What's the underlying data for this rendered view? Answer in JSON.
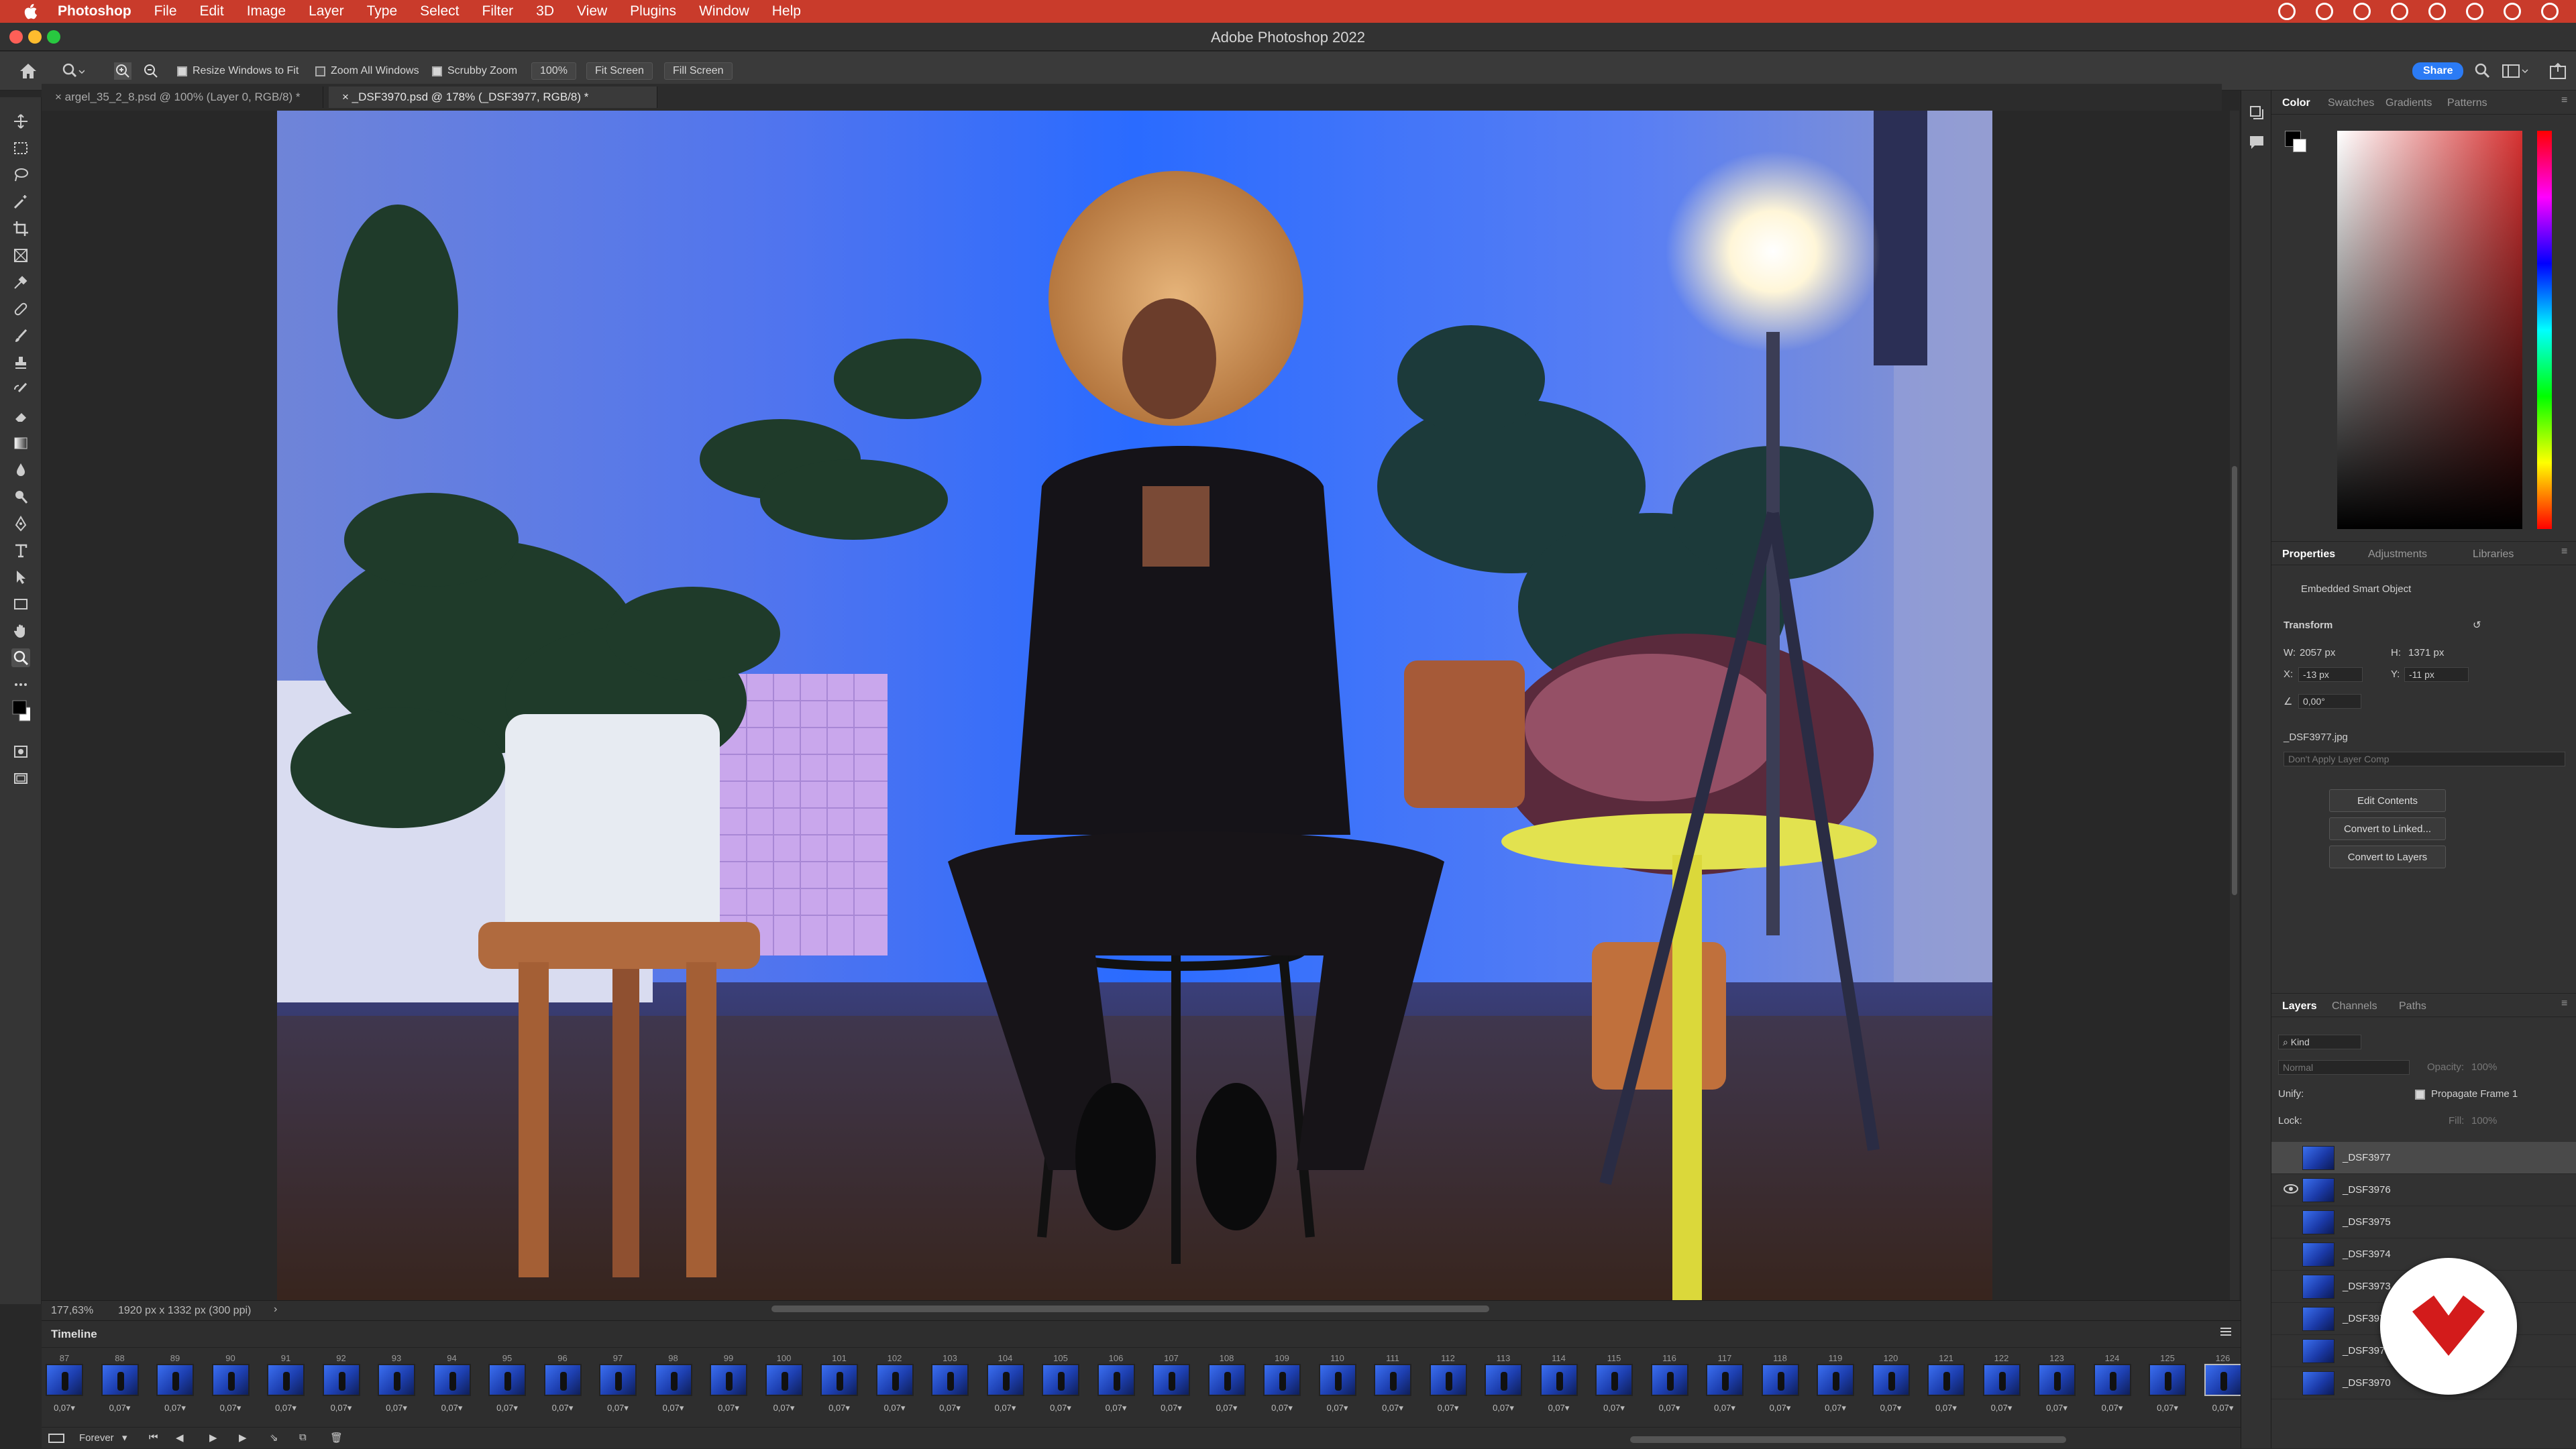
{
  "menubar": {
    "app_name": "Photoshop",
    "items": [
      "File",
      "Edit",
      "Image",
      "Layer",
      "Type",
      "Select",
      "Filter",
      "3D",
      "View",
      "Plugins",
      "Window",
      "Help"
    ]
  },
  "window": {
    "title": "Adobe Photoshop 2022"
  },
  "options_bar": {
    "resize_windows": "Resize Windows to Fit",
    "zoom_all": "Zoom All Windows",
    "scrubby_zoom": "Scrubby Zoom",
    "zoom_value": "100%",
    "fit_screen": "Fit Screen",
    "fill_screen": "Fill Screen",
    "share": "Share"
  },
  "doc_tabs": [
    {
      "label": "argel_35_2_8.psd @ 100% (Layer 0, RGB/8) *"
    },
    {
      "label": "_DSF3970.psd @ 178% (_DSF3977, RGB/8) *"
    }
  ],
  "status": {
    "zoom": "177,63%",
    "doc_size": "1920 px x 1332 px (300 ppi)"
  },
  "timeline": {
    "title": "Timeline",
    "loop": "Forever",
    "frames": [
      {
        "n": "87",
        "d": "0,07"
      },
      {
        "n": "88",
        "d": "0,07"
      },
      {
        "n": "89",
        "d": "0,07"
      },
      {
        "n": "90",
        "d": "0,07"
      },
      {
        "n": "91",
        "d": "0,07"
      },
      {
        "n": "92",
        "d": "0,07"
      },
      {
        "n": "93",
        "d": "0,07"
      },
      {
        "n": "94",
        "d": "0,07"
      },
      {
        "n": "95",
        "d": "0,07"
      },
      {
        "n": "96",
        "d": "0,07"
      },
      {
        "n": "97",
        "d": "0,07"
      },
      {
        "n": "98",
        "d": "0,07"
      },
      {
        "n": "99",
        "d": "0,07"
      },
      {
        "n": "100",
        "d": "0,07"
      },
      {
        "n": "101",
        "d": "0,07"
      },
      {
        "n": "102",
        "d": "0,07"
      },
      {
        "n": "103",
        "d": "0,07"
      },
      {
        "n": "104",
        "d": "0,07"
      },
      {
        "n": "105",
        "d": "0,07"
      },
      {
        "n": "106",
        "d": "0,07"
      },
      {
        "n": "107",
        "d": "0,07"
      },
      {
        "n": "108",
        "d": "0,07"
      },
      {
        "n": "109",
        "d": "0,07"
      },
      {
        "n": "110",
        "d": "0,07"
      },
      {
        "n": "111",
        "d": "0,07"
      },
      {
        "n": "112",
        "d": "0,07"
      },
      {
        "n": "113",
        "d": "0,07"
      },
      {
        "n": "114",
        "d": "0,07"
      },
      {
        "n": "115",
        "d": "0,07"
      },
      {
        "n": "116",
        "d": "0,07"
      },
      {
        "n": "117",
        "d": "0,07"
      },
      {
        "n": "118",
        "d": "0,07"
      },
      {
        "n": "119",
        "d": "0,07"
      },
      {
        "n": "120",
        "d": "0,07"
      },
      {
        "n": "121",
        "d": "0,07"
      },
      {
        "n": "122",
        "d": "0,07"
      },
      {
        "n": "123",
        "d": "0,07"
      },
      {
        "n": "124",
        "d": "0,07"
      },
      {
        "n": "125",
        "d": "0,07"
      },
      {
        "n": "126",
        "d": "0,07"
      }
    ]
  },
  "color_panel": {
    "tabs": [
      "Color",
      "Swatches",
      "Gradients",
      "Patterns"
    ]
  },
  "properties_panel": {
    "tabs": [
      "Properties",
      "Adjustments",
      "Libraries"
    ],
    "object_type": "Embedded Smart Object",
    "transform_label": "Transform",
    "w_label": "W:",
    "w": "2057 px",
    "h_label": "H:",
    "h": "1371 px",
    "x_label": "X:",
    "x": "-13 px",
    "y_label": "Y:",
    "y": "-11 px",
    "angle": "0,00°",
    "source_file": "_DSF3977.jpg",
    "layer_comp_placeholder": "Don't Apply Layer Comp",
    "buttons": [
      "Edit Contents",
      "Convert to Linked...",
      "Convert to Layers"
    ]
  },
  "layers_panel": {
    "tabs": [
      "Layers",
      "Channels",
      "Paths"
    ],
    "kind": "Kind",
    "blend": "Normal",
    "opacity_label": "Opacity:",
    "opacity": "100%",
    "unify_label": "Unify:",
    "propagate": "Propagate Frame 1",
    "lock_label": "Lock:",
    "fill_label": "Fill:",
    "fill": "100%",
    "layers": [
      "_DSF3977",
      "_DSF3976",
      "_DSF3975",
      "_DSF3974",
      "_DSF3973",
      "_DSF3972",
      "_DSF3971",
      "_DSF3970"
    ]
  },
  "colors": {
    "menubar": "#c93b2b",
    "accent": "#2b7bf5"
  }
}
